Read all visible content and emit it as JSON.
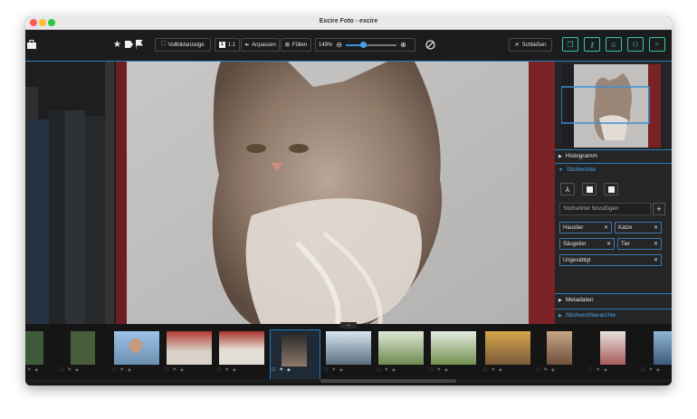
{
  "window": {
    "title": "Excire Foto - excire"
  },
  "toolbar": {
    "fullscreen_label": "Vollbildanzeige",
    "ratio_label": "1:1",
    "fit_label": "Anpassen",
    "fill_label": "Füllen",
    "zoom_value": "149%",
    "close_label": "Schließen"
  },
  "sidebar": {
    "histogram_label": "Histogramm",
    "keywords_label": "Stichwörter",
    "keyword_placeholder": "Stichwörter hinzufügen",
    "keywords": [
      "Haustier",
      "Katze",
      "Säugetier",
      "Tier",
      "Ungesättigt"
    ],
    "metadata_label": "Metadaten",
    "hierarchy_label": "Stichworthierarchie"
  },
  "colors": {
    "accent": "#35c6b2",
    "selection": "#2a7dc2"
  }
}
